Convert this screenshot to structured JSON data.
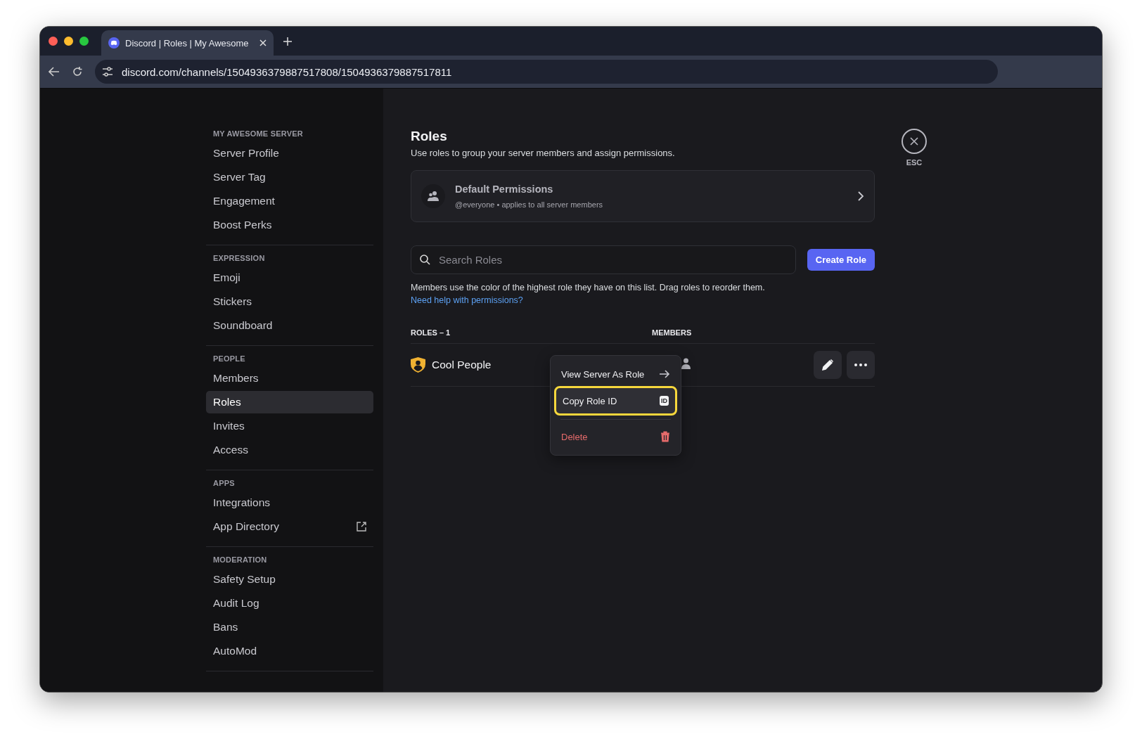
{
  "browser": {
    "tabs": [
      {
        "title": "Discord | Roles | My Awesome",
        "selected": true
      }
    ],
    "url": "discord.com/channels/1504936379887517808/1504936379887517811"
  },
  "sidebar": {
    "sections": [
      {
        "header": "MY AWESOME SERVER",
        "items": [
          {
            "label": "Server Profile",
            "kind": "page",
            "selected": false
          },
          {
            "label": "Server Tag",
            "kind": "page",
            "selected": false
          },
          {
            "label": "Engagement",
            "kind": "page",
            "selected": false
          },
          {
            "label": "Boost Perks",
            "kind": "page",
            "selected": false
          }
        ]
      },
      {
        "header": "EXPRESSION",
        "items": [
          {
            "label": "Emoji",
            "kind": "page",
            "selected": false
          },
          {
            "label": "Stickers",
            "kind": "page",
            "selected": false
          },
          {
            "label": "Soundboard",
            "kind": "page",
            "selected": false
          }
        ]
      },
      {
        "header": "PEOPLE",
        "items": [
          {
            "label": "Members",
            "kind": "page",
            "selected": false
          },
          {
            "label": "Roles",
            "kind": "page",
            "selected": true
          },
          {
            "label": "Invites",
            "kind": "page",
            "selected": false
          },
          {
            "label": "Access",
            "kind": "page",
            "selected": false
          }
        ]
      },
      {
        "header": "APPS",
        "items": [
          {
            "label": "Integrations",
            "kind": "page",
            "selected": false
          },
          {
            "label": "App Directory",
            "kind": "external",
            "selected": false
          }
        ]
      },
      {
        "header": "MODERATION",
        "items": [
          {
            "label": "Safety Setup",
            "kind": "page",
            "selected": false
          },
          {
            "label": "Audit Log",
            "kind": "page",
            "selected": false
          },
          {
            "label": "Bans",
            "kind": "page",
            "selected": false
          },
          {
            "label": "AutoMod",
            "kind": "page",
            "selected": false
          }
        ]
      }
    ]
  },
  "main": {
    "title": "Roles",
    "subtitle": "Use roles to group your server members and assign permissions.",
    "default_permissions": {
      "title": "Default Permissions",
      "subtitle": "@everyone • applies to all server members"
    },
    "search": {
      "placeholder": "Search Roles"
    },
    "create_button": "Create Role",
    "help_text": "Members use the color of the highest role they have on this list. Drag roles to reorder them.",
    "help_link": "Need help with permissions?",
    "columns": [
      "ROLES – 1",
      "MEMBERS"
    ],
    "roles": [
      {
        "name": "Cool People",
        "color": "#f0b232"
      }
    ],
    "context_menu": {
      "items": [
        {
          "label": "View Server As Role",
          "kind": "arrow",
          "selected": false
        },
        {
          "label": "Copy Role ID",
          "kind": "id",
          "badge": "ID",
          "selected": true
        },
        {
          "label": "Delete",
          "kind": "danger",
          "selected": false
        }
      ]
    }
  },
  "close": {
    "label": "ESC"
  }
}
